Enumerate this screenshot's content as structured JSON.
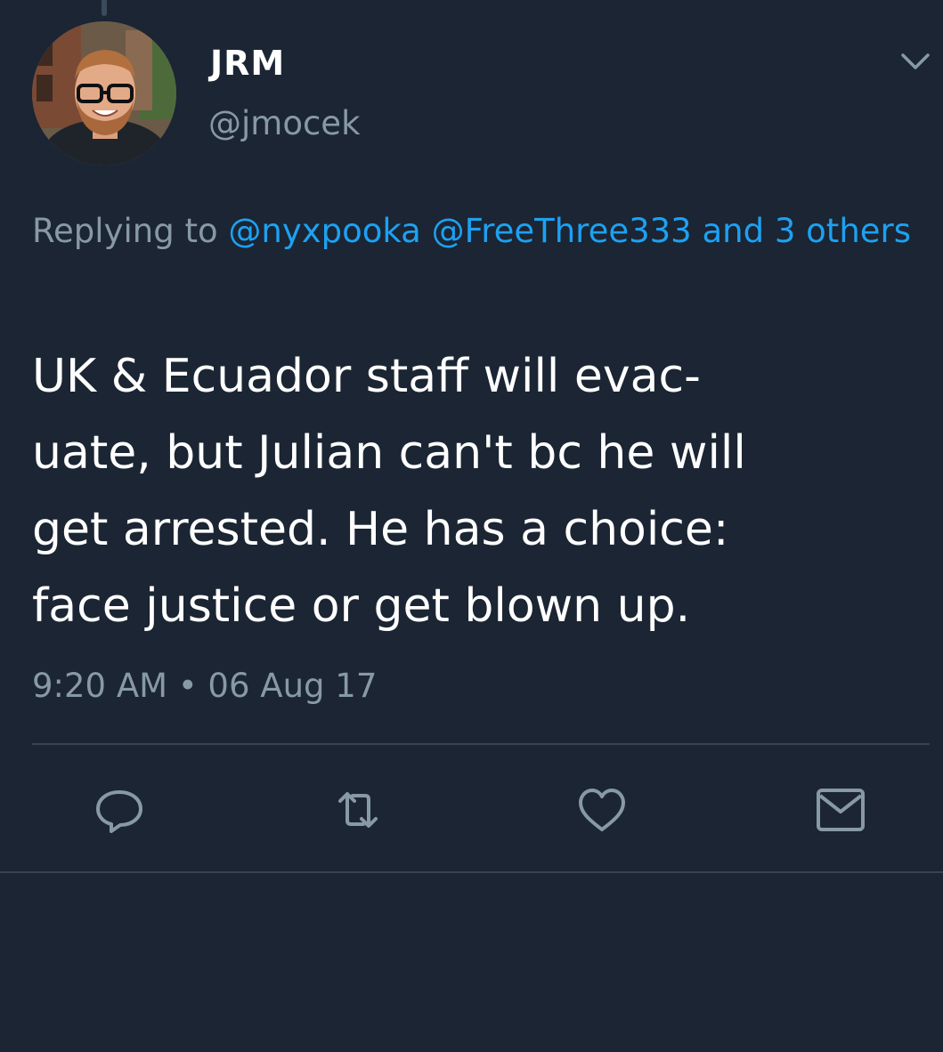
{
  "tweet": {
    "author": {
      "display_name": "JRM",
      "handle": "@jmocek",
      "avatar_icon": "user-avatar-photo"
    },
    "replying": {
      "prefix": "Replying to",
      "mentions": [
        "@nyxpooka",
        "@FreeThree333",
        "and 3 others"
      ]
    },
    "text_lines": [
      "UK & Ecuador staff will evac-",
      "uate, but Julian can't bc he will",
      "get arrested. He has a choice:",
      "face justice or get blown up."
    ],
    "timestamp": "9:20 AM • 06 Aug 17",
    "actions": {
      "reply_icon": "reply-icon",
      "retweet_icon": "retweet-icon",
      "like_icon": "heart-icon",
      "dm_icon": "envelope-icon"
    }
  },
  "colors": {
    "background": "#1b2533",
    "text": "#ffffff",
    "muted": "#8899a6",
    "link": "#1da1f2",
    "divider": "#38444d"
  }
}
